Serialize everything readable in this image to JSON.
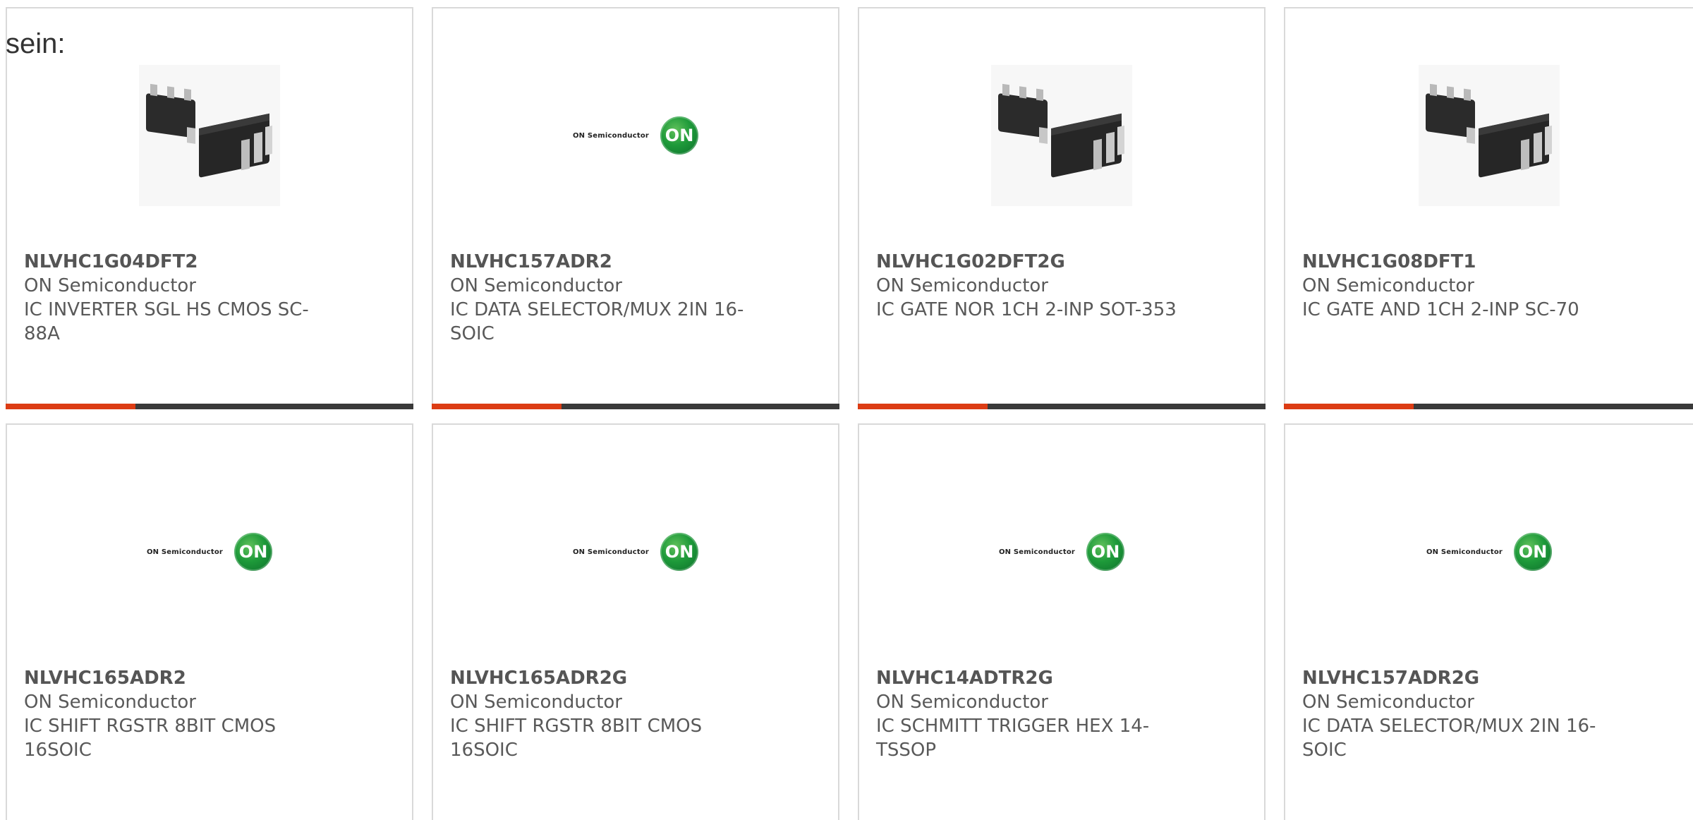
{
  "lead_text": "sein:",
  "products": [
    {
      "part_number": "NLVHC1G04DFT2",
      "manufacturer": "ON Semiconductor",
      "description": "IC INVERTER SGL HS CMOS SC-88A",
      "image": "sc88-package"
    },
    {
      "part_number": "NLVHC157ADR2",
      "manufacturer": "ON Semiconductor",
      "description": "IC DATA SELECTOR/MUX 2IN 16-SOIC",
      "image": "on-semiconductor-logo"
    },
    {
      "part_number": "NLVHC1G02DFT2G",
      "manufacturer": "ON Semiconductor",
      "description": "IC GATE NOR 1CH 2-INP SOT-353",
      "image": "sc88-package"
    },
    {
      "part_number": "NLVHC1G08DFT1",
      "manufacturer": "ON Semiconductor",
      "description": "IC GATE AND 1CH 2-INP SC-70",
      "image": "sc88-package"
    },
    {
      "part_number": "NLVHC165ADR2",
      "manufacturer": "ON Semiconductor",
      "description": "IC SHIFT RGSTR 8BIT CMOS 16SOIC",
      "image": "on-semiconductor-logo"
    },
    {
      "part_number": "NLVHC165ADR2G",
      "manufacturer": "ON Semiconductor",
      "description": "IC SHIFT RGSTR 8BIT CMOS 16SOIC",
      "image": "on-semiconductor-logo"
    },
    {
      "part_number": "NLVHC14ADTR2G",
      "manufacturer": "ON Semiconductor",
      "description": "IC SCHMITT TRIGGER HEX 14-TSSOP",
      "image": "on-semiconductor-logo"
    },
    {
      "part_number": "NLVHC157ADR2G",
      "manufacturer": "ON Semiconductor",
      "description": "IC DATA SELECTOR/MUX 2IN 16-SOIC",
      "image": "on-semiconductor-logo"
    }
  ],
  "logo": {
    "wordmark": "ON Semiconductor",
    "mark": "ON"
  },
  "colors": {
    "accent": "#dc3c14",
    "bar": "#3a3a3a",
    "border": "#d9d9d9",
    "logo_green": "#1e9a3a"
  }
}
